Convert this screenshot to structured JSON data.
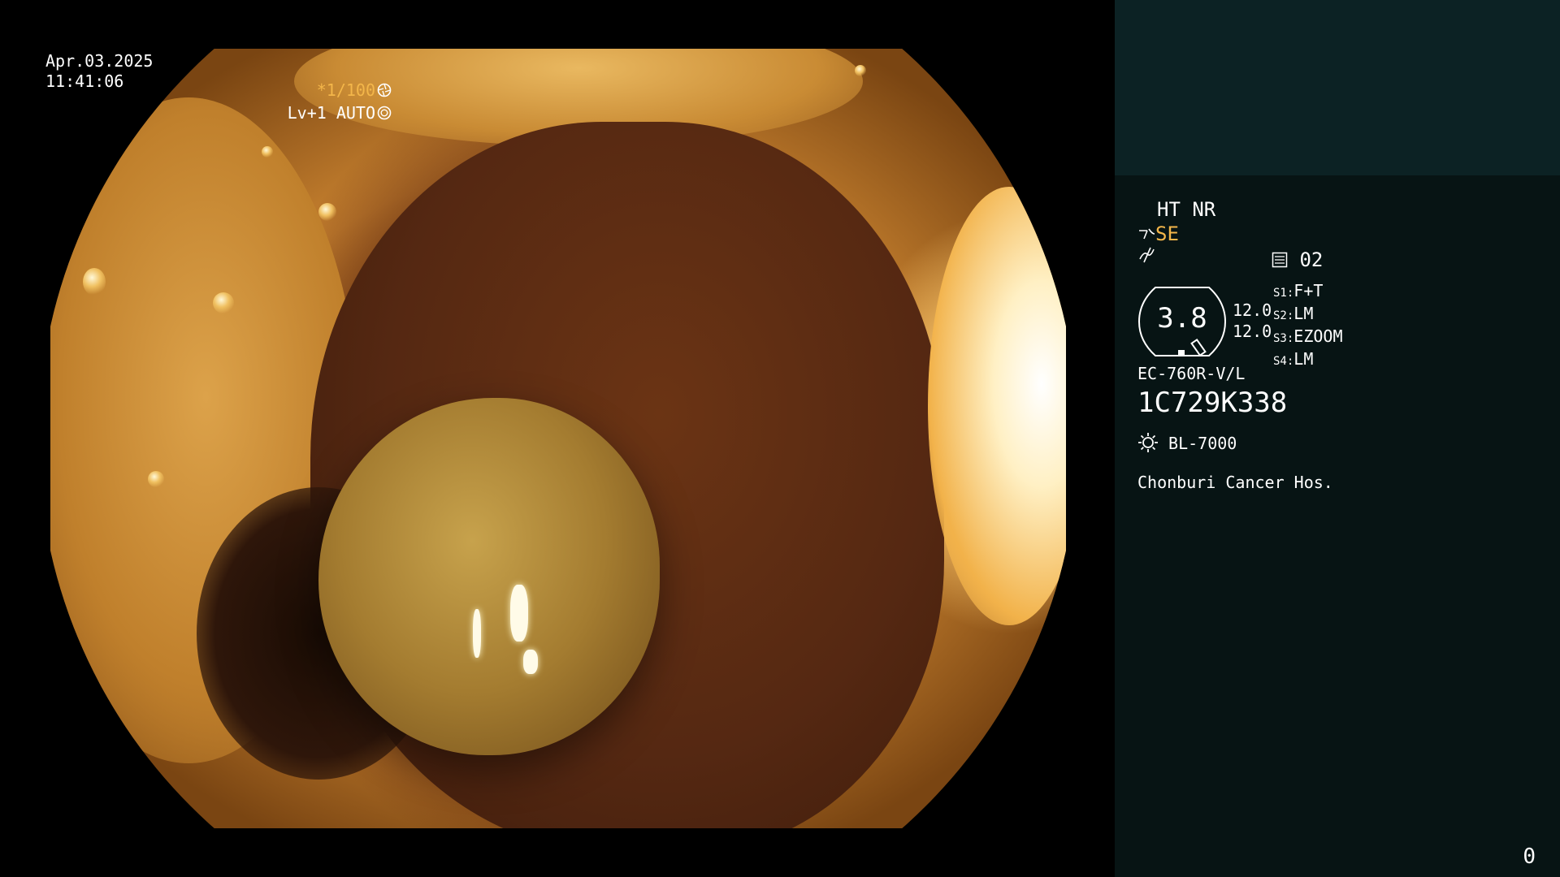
{
  "overlay": {
    "date": "Apr.03.2025",
    "time": "11:41:06",
    "shutter_prefix": "*",
    "shutter": "1/100",
    "shutter_icon": "aperture-icon",
    "level": "Lv+1 AUTO",
    "level_icon": "iris-icon"
  },
  "info": {
    "enhancement": "HT NR",
    "structure_mode": "SE",
    "structure_icon": "structure-enhance-icon",
    "gain_icon": "gain-icon",
    "photo_icon": "photo-count-icon",
    "photo_count": "02",
    "dial_value": "3.8",
    "dial_side_values": [
      "12.0",
      "12.0"
    ],
    "switches": [
      {
        "key": "S1",
        "value": "F+T"
      },
      {
        "key": "S2",
        "value": "LM"
      },
      {
        "key": "S3",
        "value": "EZOOM"
      },
      {
        "key": "S4",
        "value": "LM"
      }
    ],
    "scope_model": "EC-760R-V/L",
    "scope_serial": "1C729K338",
    "light_icon": "light-source-icon",
    "light_source": "BL-7000",
    "hospital": "Chonburi Cancer Hos."
  },
  "footer": {
    "counter": "0"
  },
  "colors": {
    "background": "#000000",
    "panel": "#071414",
    "panel_top": "#0c2224",
    "accent": "#f3b64a",
    "text": "#ffffff"
  }
}
